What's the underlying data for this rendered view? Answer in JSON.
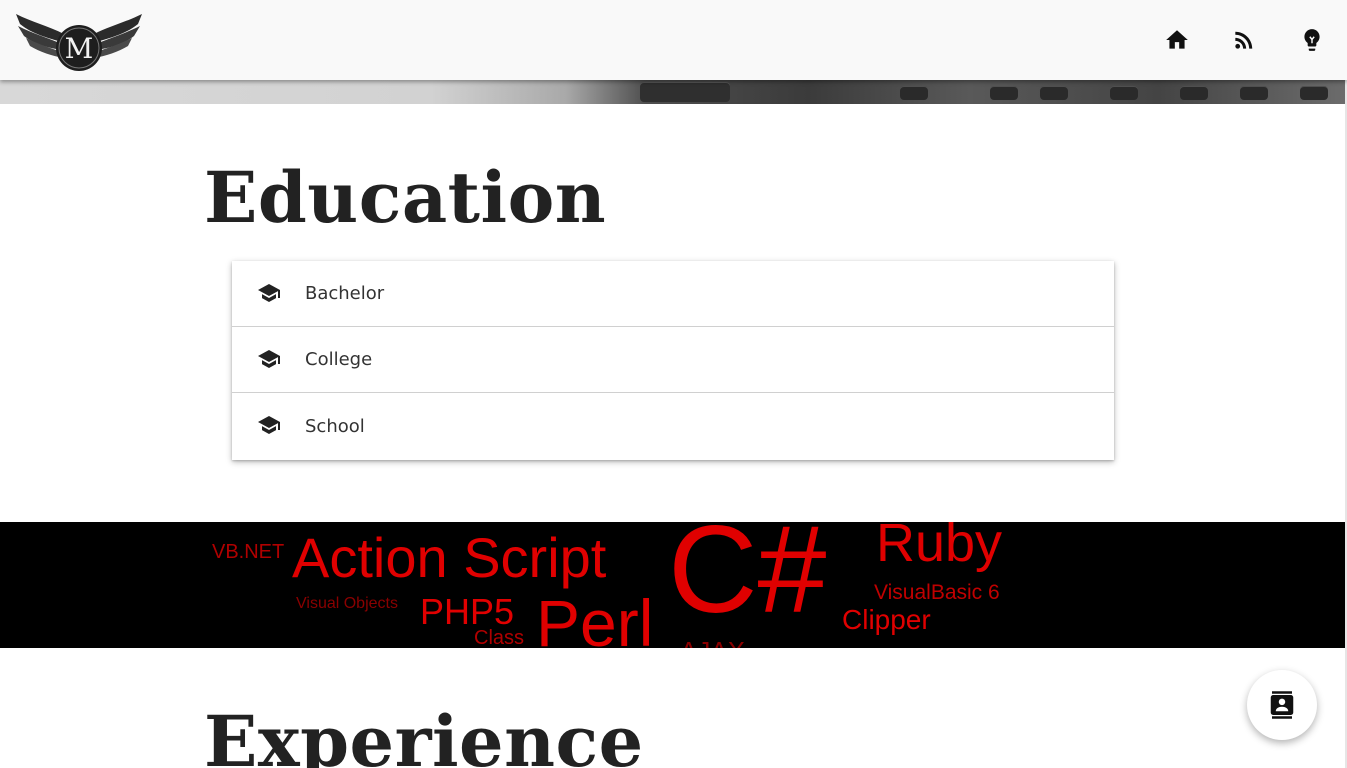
{
  "header": {
    "logo_letter": "M",
    "nav": [
      {
        "name": "home",
        "icon": "home-icon"
      },
      {
        "name": "rss",
        "icon": "rss-feed-icon"
      },
      {
        "name": "ideas",
        "icon": "lightbulb-icon"
      }
    ]
  },
  "education": {
    "title": "Education",
    "items": [
      {
        "label": "Bachelor",
        "icon": "graduation-cap-icon"
      },
      {
        "label": "College",
        "icon": "graduation-cap-icon"
      },
      {
        "label": "School",
        "icon": "graduation-cap-icon"
      }
    ]
  },
  "banner": {
    "words": [
      "VB.NET",
      "Action Script",
      "C#",
      "Ruby",
      "Visual Objects",
      "PHP5",
      "Class",
      "Perl",
      "AJAX",
      "VisualBasic 6",
      "Clipper"
    ],
    "color": "#e00000"
  },
  "experience": {
    "title": "Experience"
  },
  "fab": {
    "icon": "contact-card-icon"
  }
}
